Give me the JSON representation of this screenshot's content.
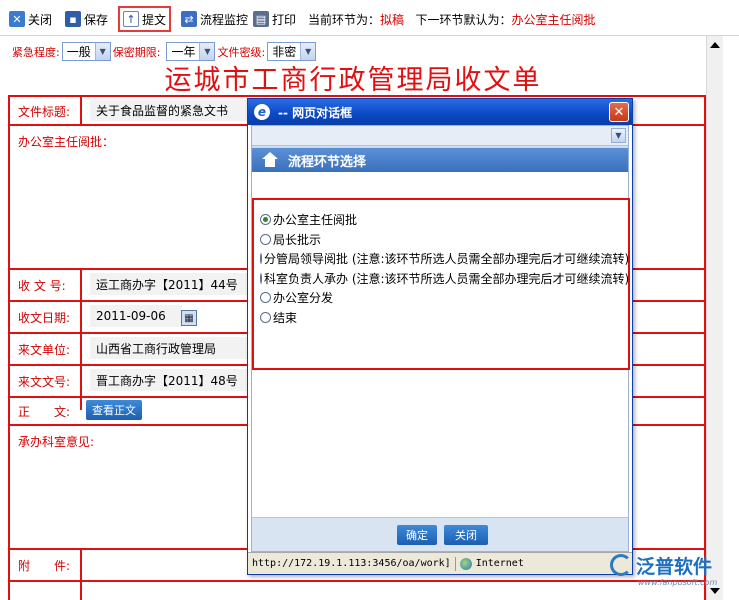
{
  "toolbar": {
    "close_label": "关闭",
    "save_label": "保存",
    "submit_label": "提文",
    "flow_label": "流程监控",
    "print_label": "打印",
    "current_step_prefix": "当前环节为：",
    "current_step": "拟稿",
    "next_step_prefix": "下一环节默认为：",
    "next_step": "办公室主任阅批"
  },
  "filters": {
    "urgency_label": "紧急程度:",
    "urgency_value": "一般",
    "secrecy_period_label": "保密期限:",
    "secrecy_period_value": "一年",
    "secrecy_level_label": "文件密级:",
    "secrecy_level_value": "非密"
  },
  "page_title": "运城市工商行政管理局收文单",
  "form": {
    "doc_title_label": "文件标题:",
    "doc_title_value": "关于食品监督的紧急文书",
    "director_review_label": "办公室主任阅批：",
    "receive_no_label": "收 文 号:",
    "receive_no_value": "运工商办字【2011】44号",
    "receive_date_label": "收文日期:",
    "receive_date_value": "2011-09-06",
    "sender_label": "来文单位:",
    "sender_value": "山西省工商行政管理局",
    "sender_no_label": "来文文号:",
    "sender_no_value": "晋工商办字【2011】48号",
    "body_label": "正　　文:",
    "view_body_button": "查看正文",
    "dept_opinion_label": "承办科室意见:",
    "attachment_label": "附　　件:"
  },
  "dialog": {
    "title": "-- 网页对话框",
    "header": "流程环节选择",
    "options": [
      {
        "label": "办公室主任阅批",
        "selected": true
      },
      {
        "label": "局长批示",
        "selected": false
      },
      {
        "label": "分管局领导阅批 (注意:该环节所选人员需全部办理完后才可继续流转)",
        "selected": false
      },
      {
        "label": "科室负责人承办 (注意:该环节所选人员需全部办理完后才可继续流转)",
        "selected": false
      },
      {
        "label": "办公室分发",
        "selected": false
      },
      {
        "label": "结束",
        "selected": false
      }
    ],
    "confirm_label": "确定",
    "close_label": "关闭",
    "status_url": "http://172.19.1.113:3456/oa/work]",
    "status_zone": "Internet"
  },
  "watermark": {
    "name": "泛普软件",
    "url": "www.fanpusoft.com"
  }
}
